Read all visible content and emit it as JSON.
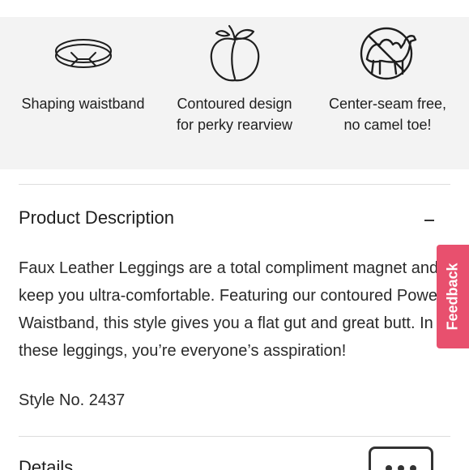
{
  "features": [
    {
      "icon": "rotating-arrows-waistband-icon",
      "caption": "Shaping waistband"
    },
    {
      "icon": "peach-icon",
      "caption": "Contoured design\nfor perky rearview"
    },
    {
      "icon": "no-camel-icon",
      "caption": "Center-seam free,\nno camel toe!"
    }
  ],
  "product_description": {
    "title": "Product Description",
    "toggle_symbol": "−",
    "body": "Faux Leather Leggings are a total compliment magnet and keep you ultra-comfortable. Featuring our contoured Power Waistband, this style gives you a flat gut and great butt. In these leggings, you’re everyone’s asspiration!",
    "style_no": "Style No. 2437"
  },
  "details": {
    "title": "Details"
  },
  "feedback_tab": {
    "label": "Feedback"
  },
  "chat_button": {
    "icon": "chat-ellipsis-icon"
  },
  "colors": {
    "feature_band_bg": "#f3f3f3",
    "feedback_bg": "#e8506e",
    "text": "#222222",
    "divider": "#dddddd"
  }
}
